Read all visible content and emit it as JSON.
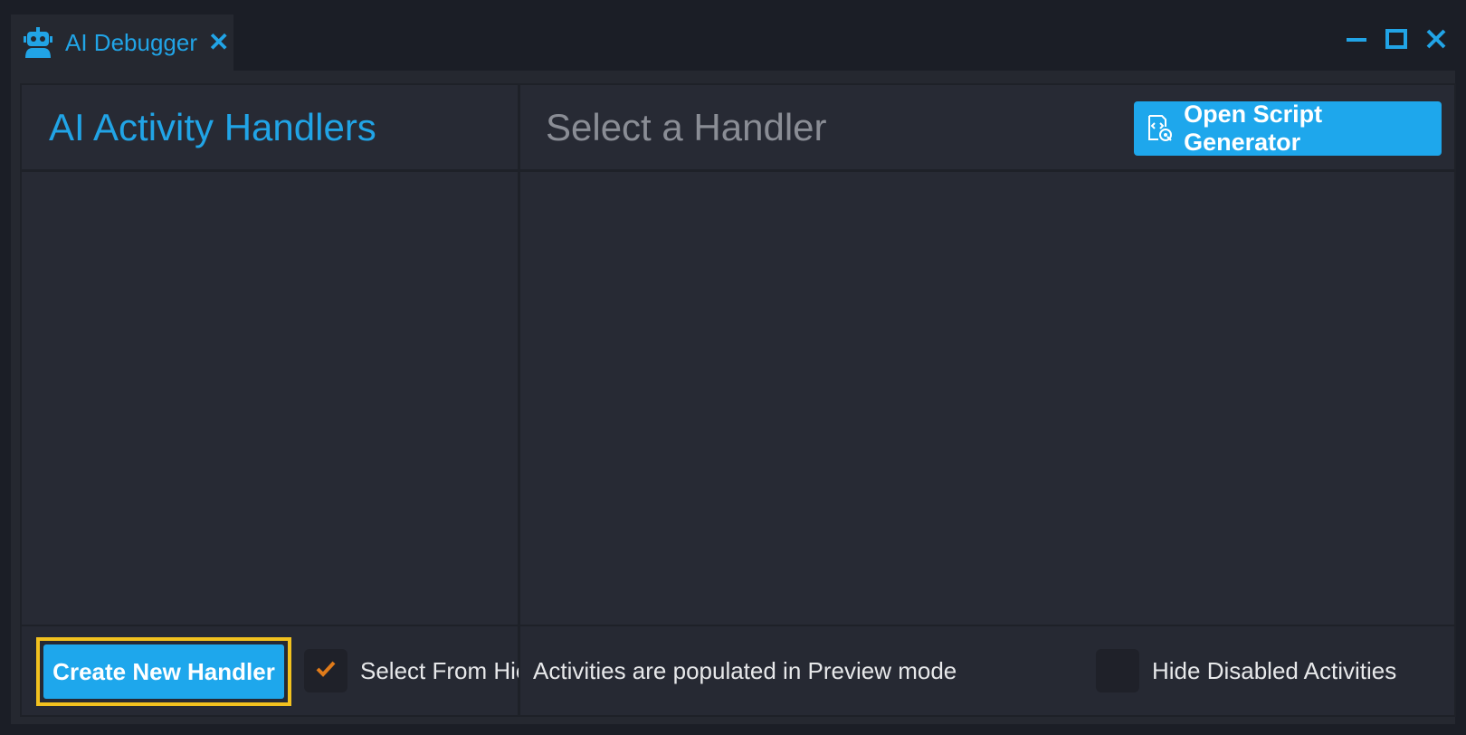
{
  "tab": {
    "title": "AI Debugger",
    "close_symbol": "✕",
    "icon": "robot-icon"
  },
  "window_controls": {
    "minimize_icon": "minimize-icon",
    "maximize_icon": "maximize-icon",
    "close_icon": "close-icon"
  },
  "left_panel": {
    "title": "AI Activity Handlers",
    "create_button_label": "Create New Handler",
    "select_from_hierarchy": {
      "label": "Select From Hierarchy",
      "checked": true
    }
  },
  "right_panel": {
    "title": "Select a Handler",
    "script_button_label": "Open Script Generator",
    "script_button_icon": "script-code-icon",
    "info_text": "Activities are populated in Preview mode",
    "hide_disabled": {
      "label": "Hide Disabled Activities",
      "checked": false
    }
  },
  "colors": {
    "accent": "#1ea7ec",
    "highlight_border": "#f2c11f",
    "check_mark": "#e07b1a",
    "background": "#1b1e26",
    "panel": "#272a34"
  }
}
